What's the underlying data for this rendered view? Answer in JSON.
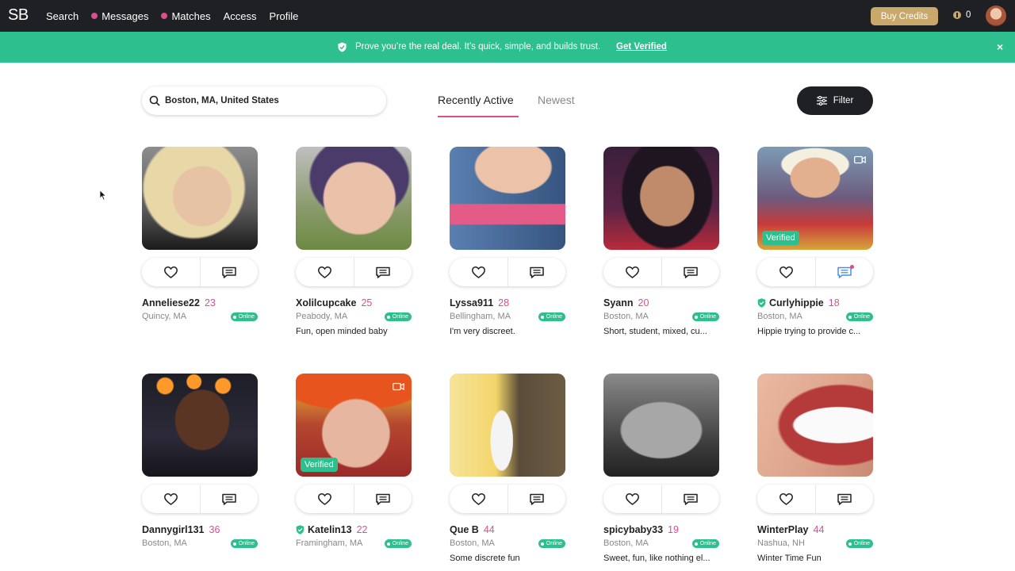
{
  "nav": {
    "logo": "SB",
    "links": [
      {
        "label": "Search",
        "dot": false
      },
      {
        "label": "Messages",
        "dot": true
      },
      {
        "label": "Matches",
        "dot": true
      },
      {
        "label": "Access",
        "dot": false
      },
      {
        "label": "Profile",
        "dot": false
      }
    ],
    "buy_credits": "Buy Credits",
    "credits_count": "0"
  },
  "banner": {
    "message": "Prove you’re the real deal. It’s quick, simple, and builds trust.",
    "link": "Get Verified",
    "close": "×"
  },
  "search": {
    "location": "Boston, MA, United States"
  },
  "tabs": {
    "recent": "Recently Active",
    "newest": "Newest"
  },
  "filter_label": "Filter",
  "profiles": [
    {
      "name": "Anneliese22",
      "age": "23",
      "location": "Quincy, MA",
      "tagline": "",
      "verified": false,
      "video": false,
      "online": "Online"
    },
    {
      "name": "Xolilcupcake",
      "age": "25",
      "location": "Peabody, MA",
      "tagline": "Fun, open minded baby",
      "verified": false,
      "video": false,
      "online": "Online"
    },
    {
      "name": "Lyssa911",
      "age": "28",
      "location": "Bellingham, MA",
      "tagline": "I'm very discreet.",
      "verified": false,
      "video": false,
      "online": "Online"
    },
    {
      "name": "Syann",
      "age": "20",
      "location": "Boston, MA",
      "tagline": "Short, student, mixed, cu...",
      "verified": false,
      "video": false,
      "online": "Online"
    },
    {
      "name": "Curlyhippie",
      "age": "18",
      "location": "Boston, MA",
      "tagline": "Hippie trying to provide c...",
      "verified": true,
      "video": true,
      "online": "Online",
      "photo_badge": "Verified",
      "new_message": true
    },
    {
      "name": "Dannygirl131",
      "age": "36",
      "location": "Boston, MA",
      "tagline": "",
      "verified": false,
      "video": false,
      "online": "Online"
    },
    {
      "name": "Katelin13",
      "age": "22",
      "location": "Framingham, MA",
      "tagline": "",
      "verified": true,
      "video": true,
      "online": "Online",
      "photo_badge": "Verified"
    },
    {
      "name": "Que B",
      "age": "44",
      "location": "Boston, MA",
      "tagline": "Some discrete fun",
      "verified": false,
      "video": false,
      "online": "Online"
    },
    {
      "name": "spicybaby33",
      "age": "19",
      "location": "Boston, MA",
      "tagline": "Sweet, fun, like nothing el...",
      "verified": false,
      "video": false,
      "online": "Online"
    },
    {
      "name": "WinterPlay",
      "age": "44",
      "location": "Nashua, NH",
      "tagline": "Winter Time Fun",
      "verified": false,
      "video": false,
      "online": "Online"
    }
  ],
  "colors": {
    "nav_bg": "#1f2024",
    "accent_pink": "#d94f8e",
    "accent_green": "#2dbf8d",
    "gold": "#c8a86b"
  }
}
